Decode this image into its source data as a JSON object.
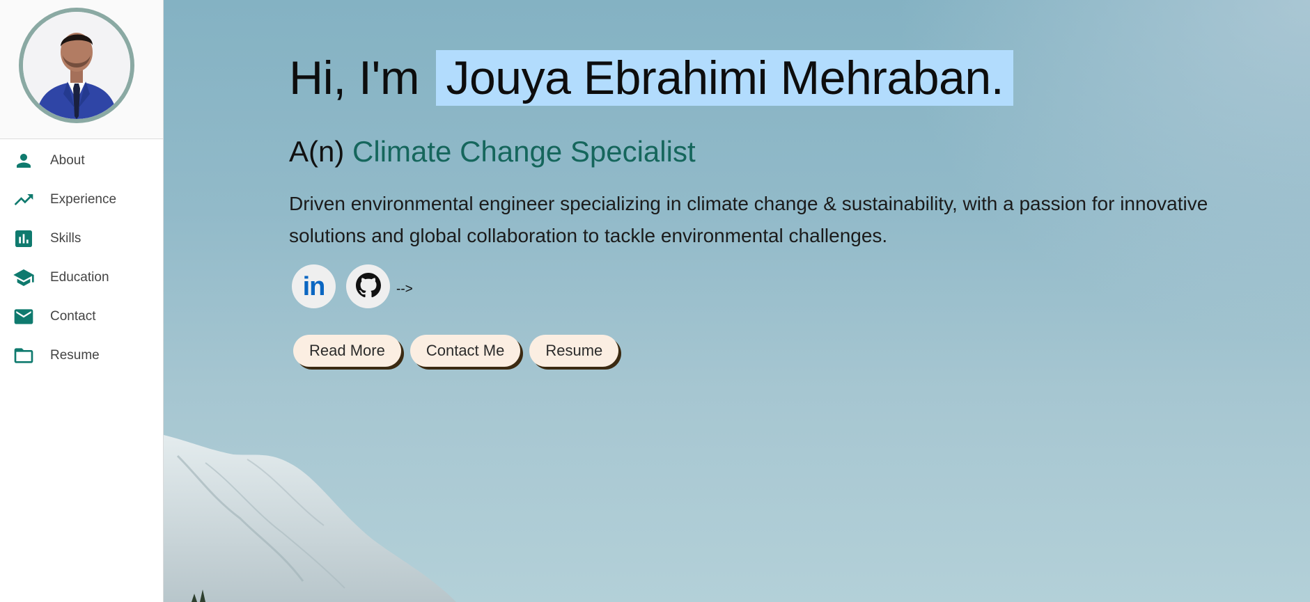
{
  "colors": {
    "accent": "#0f7a6e",
    "name_highlight": "#b2dcfd",
    "role_title": "#15665c",
    "button_bg": "#fbeee2",
    "button_shadow": "#3b2a12"
  },
  "sidebar": {
    "items": [
      {
        "label": "About",
        "icon": "person-icon"
      },
      {
        "label": "Experience",
        "icon": "trending-up-icon"
      },
      {
        "label": "Skills",
        "icon": "bar-chart-icon"
      },
      {
        "label": "Education",
        "icon": "graduation-cap-icon"
      },
      {
        "label": "Contact",
        "icon": "mail-icon"
      },
      {
        "label": "Resume",
        "icon": "folder-icon"
      }
    ]
  },
  "hero": {
    "greeting": "Hi, I'm",
    "name": "Jouya Ebrahimi Mehraban.",
    "role_prefix": "A(n)",
    "role_title": "Climate Change Specialist",
    "bio": "Driven environmental engineer specializing in climate change & sustainability, with a passion for innovative solutions and global collaboration to tackle environmental challenges.",
    "socials": [
      {
        "name": "linkedin",
        "label": "in"
      },
      {
        "name": "github",
        "icon": "github-icon"
      }
    ],
    "stray_text": "-->",
    "buttons": {
      "read_more": "Read More",
      "contact_me": "Contact Me",
      "resume": "Resume"
    }
  }
}
